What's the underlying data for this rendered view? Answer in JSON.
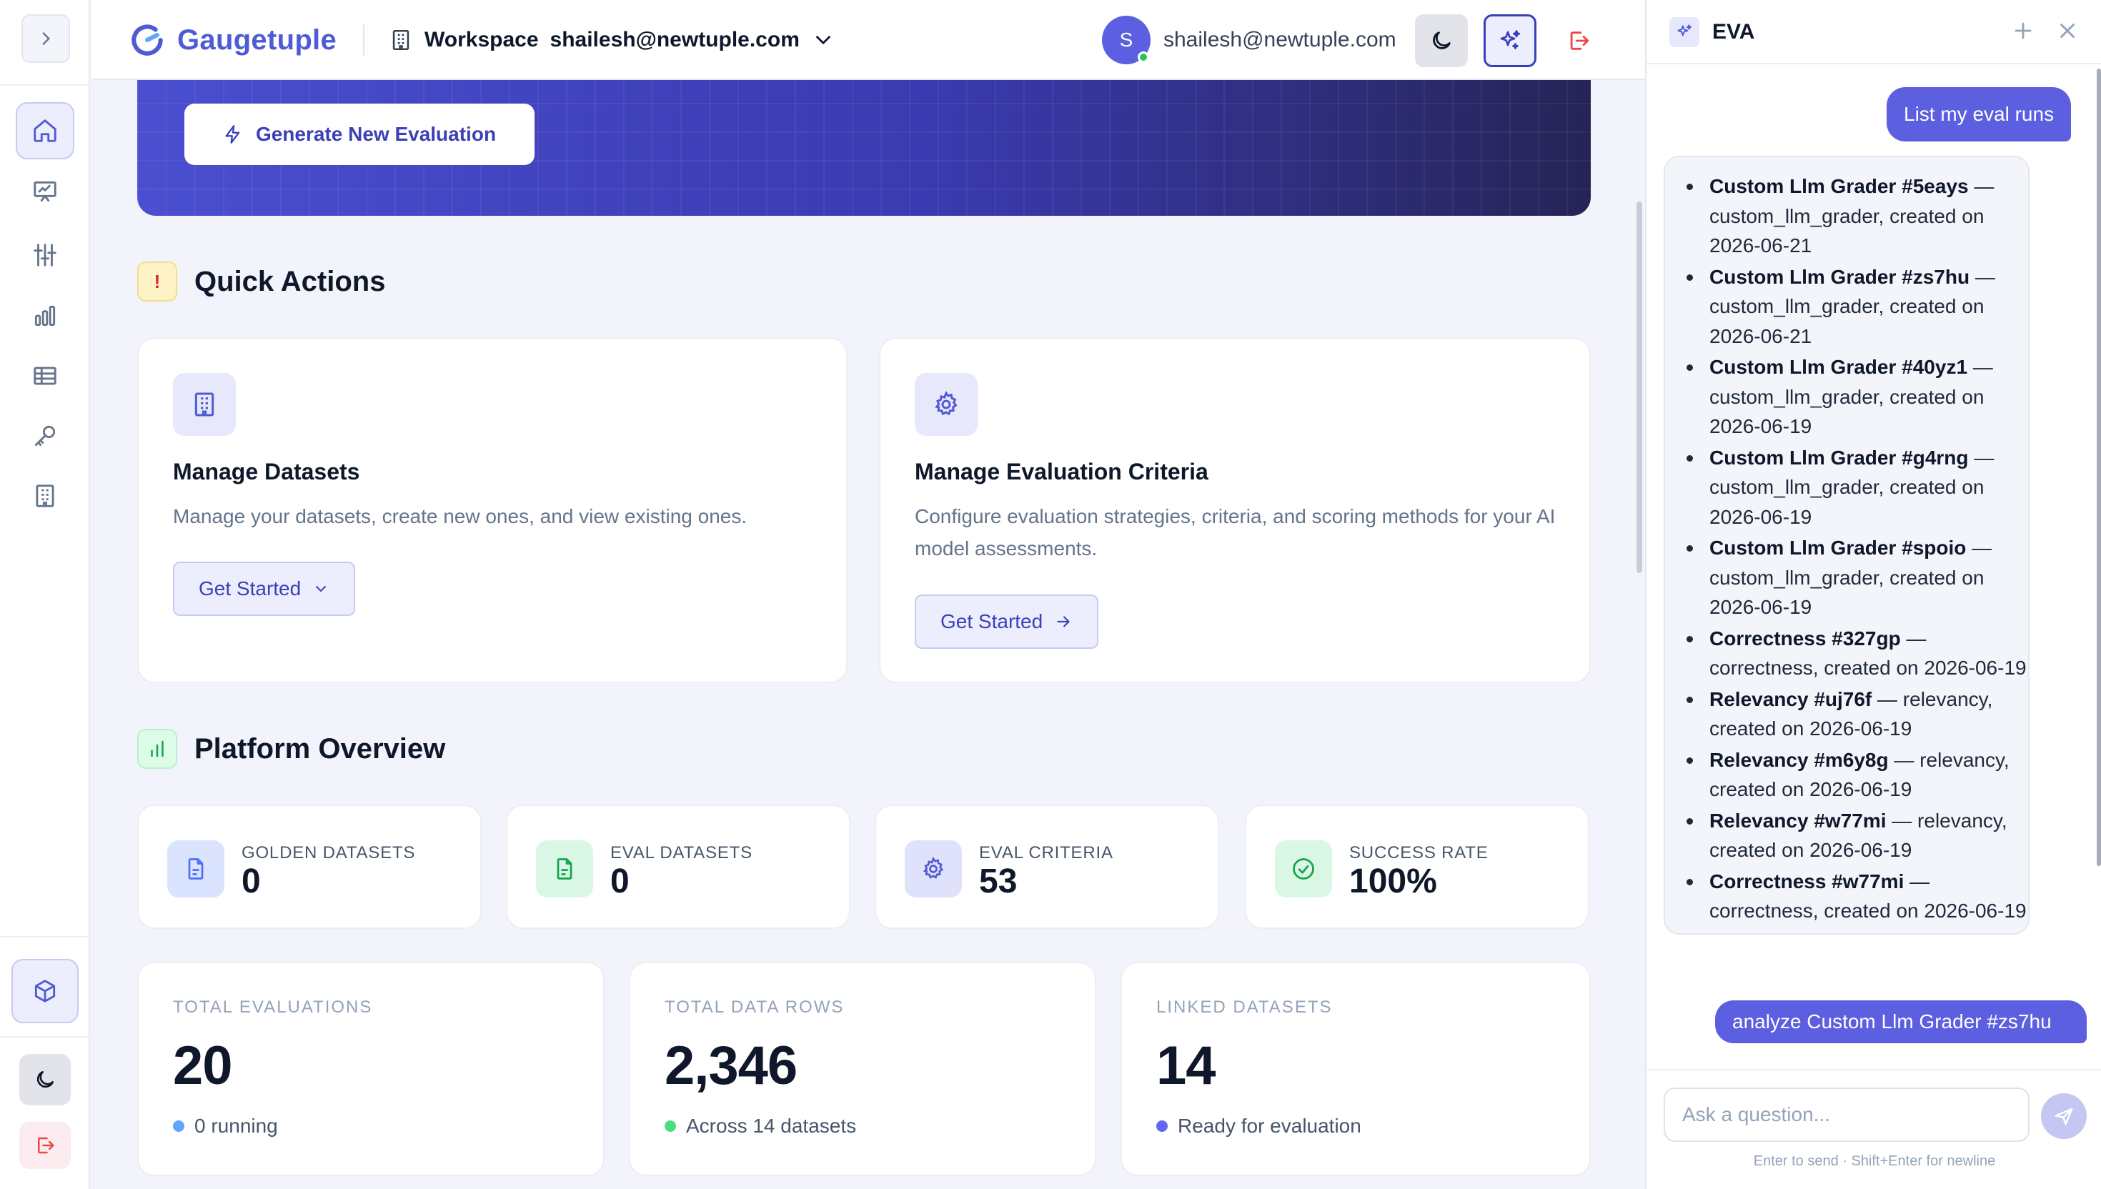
{
  "header": {
    "brand": "Gaugetuple",
    "workspace_label": "Workspace",
    "workspace_email": "shailesh@newtuple.com",
    "avatar_initial": "S",
    "user_email": "shailesh@newtuple.com"
  },
  "rail": {
    "items": [
      "home-icon",
      "presentation-icon",
      "sliders-icon",
      "bar-chart-icon",
      "table-icon",
      "key-icon",
      "building-icon"
    ],
    "active": "home-icon"
  },
  "hero": {
    "button_label": "Generate New Evaluation"
  },
  "quick_actions": {
    "title": "Quick Actions",
    "cards": [
      {
        "title": "Manage Datasets",
        "description": "Manage your datasets, create new ones, and view existing ones.",
        "button": "Get Started"
      },
      {
        "title": "Manage Evaluation Criteria",
        "description": "Configure evaluation strategies, criteria, and scoring methods for your AI model assessments.",
        "button": "Get Started"
      }
    ]
  },
  "platform_overview": {
    "title": "Platform Overview",
    "stats": [
      {
        "label": "GOLDEN DATASETS",
        "value": "0",
        "icon": "document-icon",
        "color": "#4f6ef7"
      },
      {
        "label": "EVAL DATASETS",
        "value": "0",
        "icon": "document-icon",
        "color": "#16a34a"
      },
      {
        "label": "EVAL CRITERIA",
        "value": "53",
        "icon": "gear-icon",
        "color": "#4f5bd5"
      },
      {
        "label": "SUCCESS RATE",
        "value": "100%",
        "icon": "check-circle-icon",
        "color": "#16a34a"
      }
    ],
    "totals": [
      {
        "label": "TOTAL EVALUATIONS",
        "value": "20",
        "sub": "0 running",
        "dot": "#60a5fa"
      },
      {
        "label": "TOTAL DATA ROWS",
        "value": "2,346",
        "sub": "Across 14 datasets",
        "dot": "#4ade80"
      },
      {
        "label": "LINKED DATASETS",
        "value": "14",
        "sub": "Ready for evaluation",
        "dot": "#6366f1"
      }
    ]
  },
  "eva": {
    "title": "EVA",
    "messages": [
      {
        "role": "user",
        "text": "List my eval runs"
      },
      {
        "role": "assistant",
        "items": [
          {
            "name": "Custom Llm Grader #5eays",
            "rest": " — custom_llm_grader, created on 2026-06-21"
          },
          {
            "name": "Custom Llm Grader #zs7hu",
            "rest": " — custom_llm_grader, created on 2026-06-21"
          },
          {
            "name": "Custom Llm Grader #40yz1",
            "rest": " — custom_llm_grader, created on 2026-06-19"
          },
          {
            "name": "Custom Llm Grader #g4rng",
            "rest": " — custom_llm_grader, created on 2026-06-19"
          },
          {
            "name": "Custom Llm Grader #spoio",
            "rest": " — custom_llm_grader, created on 2026-06-19"
          },
          {
            "name": "Correctness #327gp",
            "rest": " — correctness, created on 2026-06-19"
          },
          {
            "name": "Relevancy #uj76f",
            "rest": " — relevancy, created on 2026-06-19"
          },
          {
            "name": "Relevancy #m6y8g",
            "rest": " — relevancy, created on 2026-06-19"
          },
          {
            "name": "Relevancy #w77mi",
            "rest": " — relevancy, created on 2026-06-19"
          },
          {
            "name": "Correctness #w77mi",
            "rest": " — correctness, created on 2026-06-19"
          }
        ]
      },
      {
        "role": "user",
        "text": "analyze Custom Llm Grader #zs7hu"
      }
    ],
    "input_placeholder": "Ask a question...",
    "hint": "Enter to send · Shift+Enter for newline"
  }
}
